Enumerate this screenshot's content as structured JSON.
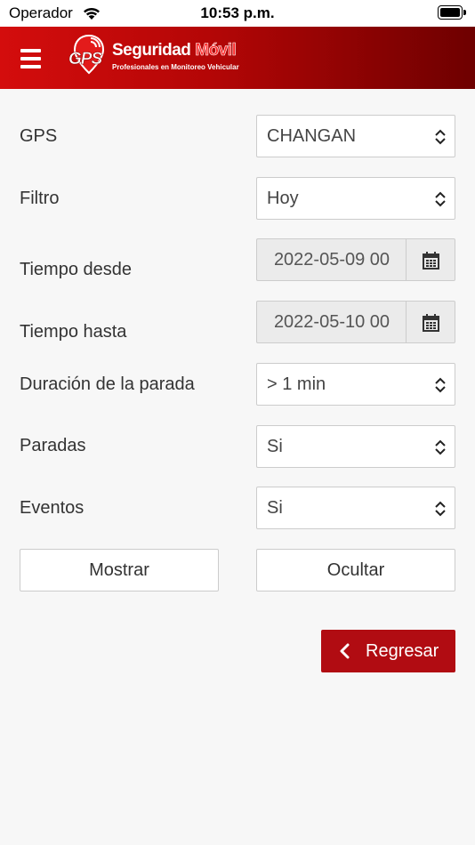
{
  "status_bar": {
    "carrier": "Operador",
    "time": "10:53 p.m."
  },
  "header": {
    "logo_badge": "GPS",
    "logo_title_part1": "Seguridad ",
    "logo_title_part2": "Móvil",
    "logo_subtitle": "Profesionales en Monitoreo Vehicular",
    "menu_icon": "hamburger-icon",
    "brand_colors": [
      "#d40d0d",
      "#6e0000"
    ]
  },
  "form": {
    "gps": {
      "label": "GPS",
      "value": "CHANGAN"
    },
    "filtro": {
      "label": "Filtro",
      "value": "Hoy"
    },
    "tiempo_desde": {
      "label": "Tiempo desde",
      "value": "2022-05-09 00"
    },
    "tiempo_hasta": {
      "label": "Tiempo hasta",
      "value": "2022-05-10 00"
    },
    "duracion": {
      "label": "Duración de la parada",
      "value": "> 1 min"
    },
    "paradas": {
      "label": "Paradas",
      "value": "Si"
    },
    "eventos": {
      "label": "Eventos",
      "value": "Si"
    }
  },
  "buttons": {
    "mostrar": "Mostrar",
    "ocultar": "Ocultar",
    "regresar": "Regresar",
    "regresar_color": "#b10c12"
  }
}
